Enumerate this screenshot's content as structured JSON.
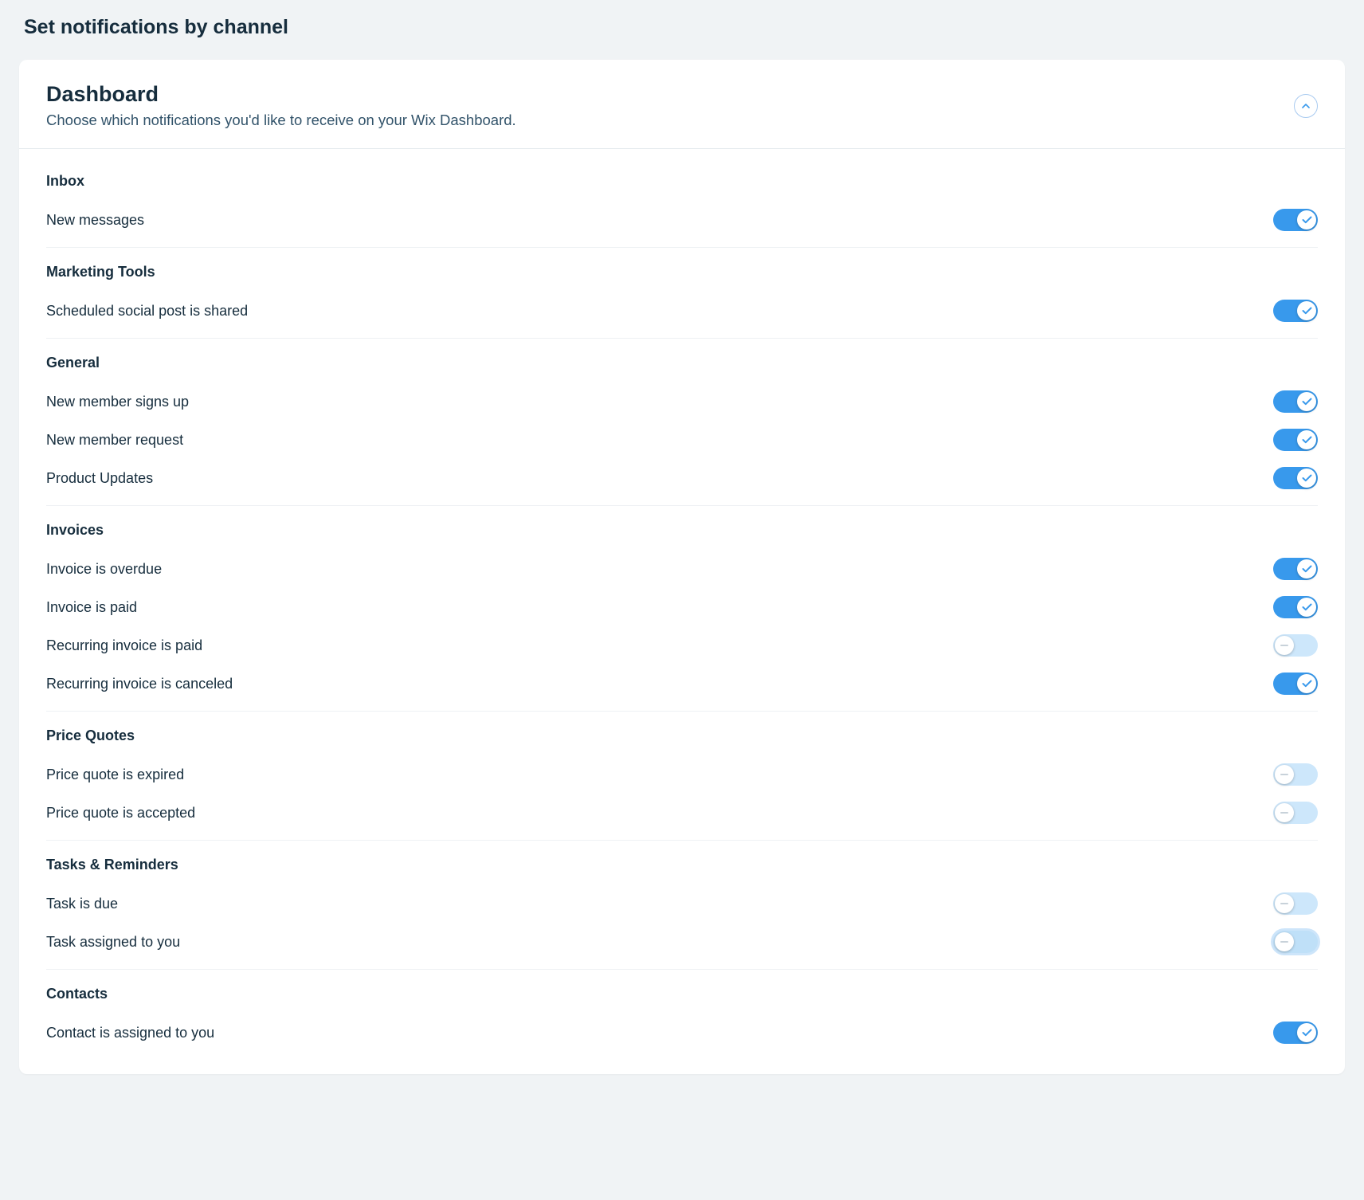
{
  "page": {
    "title": "Set notifications by channel"
  },
  "card": {
    "title": "Dashboard",
    "subtitle": "Choose which notifications you'd like to receive on your Wix Dashboard."
  },
  "groups": [
    {
      "title": "Inbox",
      "items": [
        {
          "label": "New messages",
          "on": true
        }
      ]
    },
    {
      "title": "Marketing Tools",
      "items": [
        {
          "label": "Scheduled social post is shared",
          "on": true
        }
      ]
    },
    {
      "title": "General",
      "items": [
        {
          "label": "New member signs up",
          "on": true
        },
        {
          "label": "New member request",
          "on": true
        },
        {
          "label": "Product Updates",
          "on": true
        }
      ]
    },
    {
      "title": "Invoices",
      "items": [
        {
          "label": "Invoice is overdue",
          "on": true
        },
        {
          "label": "Invoice is paid",
          "on": true
        },
        {
          "label": "Recurring invoice is paid",
          "on": false
        },
        {
          "label": "Recurring invoice is canceled",
          "on": true
        }
      ]
    },
    {
      "title": "Price Quotes",
      "items": [
        {
          "label": "Price quote is expired",
          "on": false
        },
        {
          "label": "Price quote is accepted",
          "on": false
        }
      ]
    },
    {
      "title": "Tasks & Reminders",
      "items": [
        {
          "label": "Task is due",
          "on": false
        },
        {
          "label": "Task assigned to you",
          "on": false,
          "focused": true
        }
      ]
    },
    {
      "title": "Contacts",
      "items": [
        {
          "label": "Contact is assigned to you",
          "on": true
        }
      ]
    }
  ]
}
